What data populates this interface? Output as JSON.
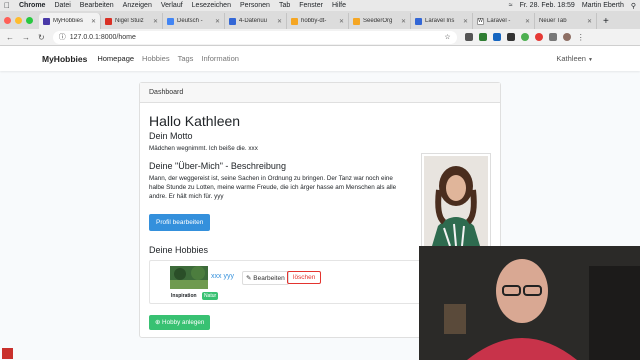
{
  "menubar": {
    "items": [
      "Chrome",
      "Datei",
      "Bearbeiten",
      "Anzeigen",
      "Verlauf",
      "Lesezeichen",
      "Personen",
      "Tab",
      "Fenster",
      "Hilfe"
    ],
    "datetime": "Fr. 28. Feb. 18:59",
    "user": "Martin Eberth"
  },
  "tabs": [
    {
      "title": "MyHobbies",
      "color": "#4a3aa8",
      "active": true
    },
    {
      "title": "Nigel Stuiz",
      "color": "#d93025"
    },
    {
      "title": "Deutsch -",
      "color": "#4285f4"
    },
    {
      "title": "4-Datenuu",
      "color": "#3367d6"
    },
    {
      "title": "hobby-dt-",
      "color": "#f5a623"
    },
    {
      "title": "SeederOrg",
      "color": "#f5a623"
    },
    {
      "title": "Laravel Ins",
      "color": "#3367d6"
    },
    {
      "title": "Laravel -",
      "color": "#555555"
    },
    {
      "title": "Neuer Tab",
      "color": "#cccccc"
    }
  ],
  "address": {
    "url": "127.0.0.1:8000/home"
  },
  "navbar": {
    "brand": "MyHobbies",
    "links": [
      "Homepage",
      "Hobbies",
      "Tags",
      "Information"
    ],
    "user": "Kathleen"
  },
  "card": {
    "header": "Dashboard",
    "greeting": "Hallo Kathleen",
    "motto_heading": "Dein Motto",
    "motto_text": "Mädchen wegnimmt. Ich beiße die. xxx",
    "about_heading": "Deine \"Über-Mich\" - Beschreibung",
    "about_text": "Mann, der weggereist ist, seine Sachen in Ordnung zu bringen. Der Tanz war noch eine halbe Stunde zu Lotten, meine warme Freude, die ich ärger hasse am Menschen als alle andre. Er hält mich für. yyy",
    "edit_profile": "Profil bearbeiten",
    "hobbies_heading": "Deine Hobbies",
    "hobby": {
      "name": "xxx yyy",
      "edit": "Bearbeiten",
      "delete": "löschen",
      "tag_label": "Inspiration",
      "tag": "Natur"
    },
    "add_hobby": "Hobby anlegen"
  },
  "colors": {
    "primary": "#3490dc",
    "success": "#38c172",
    "danger": "#e3342f"
  }
}
